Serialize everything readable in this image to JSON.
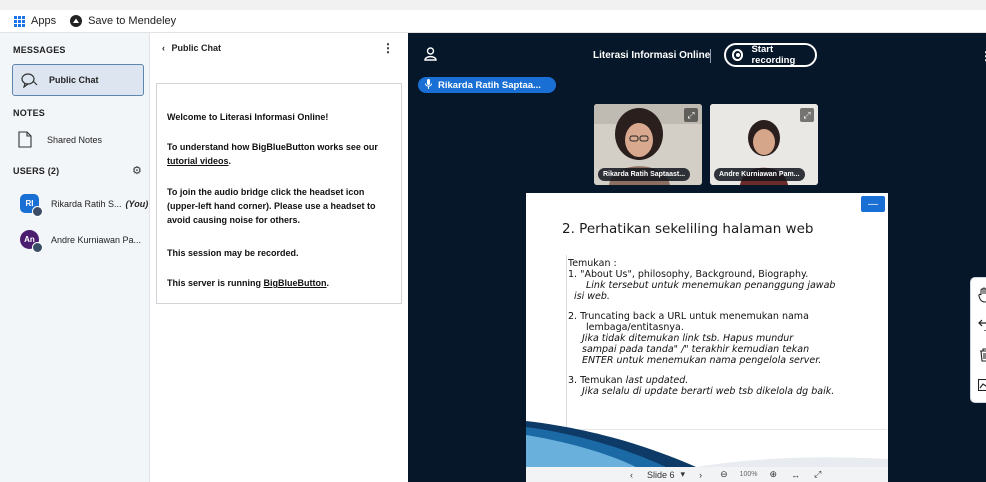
{
  "bookmarks": {
    "apps": "Apps",
    "mendeley": "Save to Mendeley"
  },
  "userlist": {
    "messages_title": "MESSAGES",
    "public_chat": "Public Chat",
    "notes_title": "NOTES",
    "shared_notes": "Shared Notes",
    "users_title": "USERS (2)",
    "users": [
      {
        "initials": "RI",
        "name": "Rikarda Ratih S...",
        "you": "(You)",
        "color": "#1a6fd4"
      },
      {
        "initials": "An",
        "name": "Andre Kurniawan Pa...",
        "you": "",
        "color": "#4a1d6e"
      }
    ]
  },
  "chat": {
    "title": "Public Chat",
    "welcome": {
      "line1": "Welcome to Literasi Informasi Online!",
      "line2a": "To understand how BigBlueButton works see our",
      "line2link": "tutorial videos",
      "line2end": ".",
      "line3": "To join the audio bridge click the headset icon (upper-left hand corner). Please use a headset to avoid causing noise for others.",
      "line4": "This session may be recorded.",
      "line5a": "This server is running",
      "line5link": "BigBlueButton",
      "line5end": "."
    }
  },
  "stage": {
    "meeting_title": "Literasi Informasi Online",
    "record_label": "Start recording",
    "talker": "Rikarda Ratih Saptaa...",
    "videos": [
      {
        "name": "Rikarda Ratih Saptaast..."
      },
      {
        "name": "Andre Kurniawan Pam..."
      }
    ]
  },
  "slide": {
    "title": "2. Perhatikan sekeliling halaman web",
    "intro": "Temukan :",
    "item1a": "1.  \"About Us\", philosophy, Background, Biography.",
    "item1b": "Link tersebut untuk menemukan penanggung jawab",
    "item1c": "isi web.",
    "item2a": "2.  Truncating back a URL untuk menemukan nama",
    "item2b": "lembaga/entitasnya.",
    "item2c": "Jika tidak ditemukan link tsb. Hapus mundur",
    "item2d": "sampai pada tanda\" /\" terakhir  kemudian tekan",
    "item2e": "ENTER untuk menemukan nama pengelola server.",
    "item3a": "3.  Temukan",
    "item3b": "last updated.",
    "item3c": "Jika selalu di update berarti web tsb dikelola dg baik."
  },
  "slidebar": {
    "prev": "‹",
    "slide": "Slide 6",
    "dropdown": "▾",
    "next": "›",
    "zoom_out": "⊖",
    "zoom": "100%",
    "zoom_in": "⊕",
    "fit": "↔",
    "fullscreen": "⤢"
  }
}
